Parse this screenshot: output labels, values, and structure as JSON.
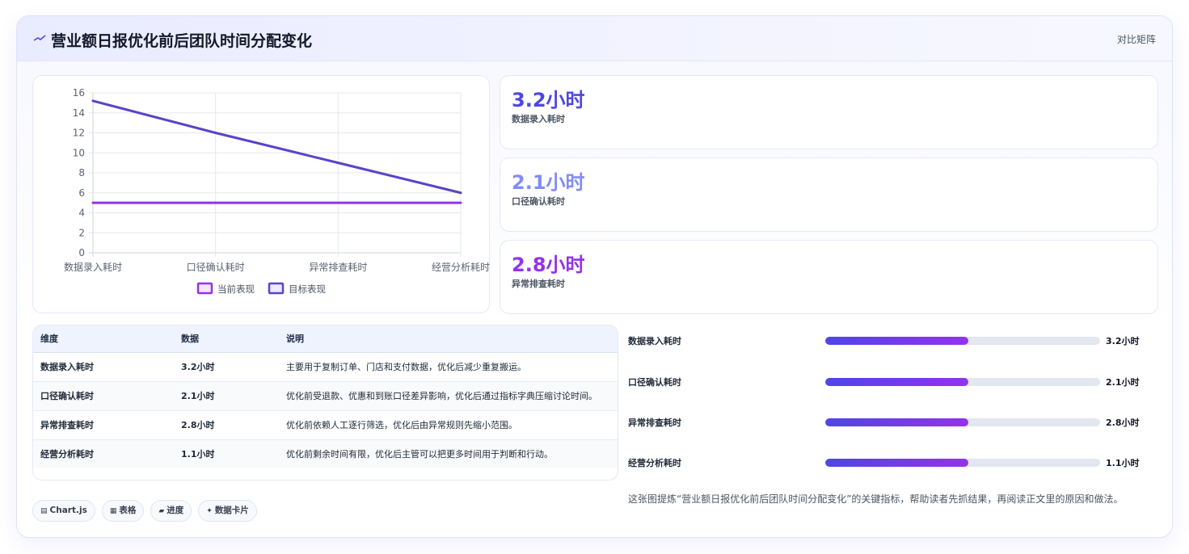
{
  "header": {
    "icon": "trend-line-icon",
    "title": "营业额日报优化前后团队时间分配变化",
    "link": "对比矩阵"
  },
  "colors": {
    "current_series": "#9333ea",
    "target_series": "#5b43c9",
    "stat1": "#4f46e5",
    "stat2": "#818cf8",
    "stat3": "#9333ea"
  },
  "chart_data": {
    "type": "line",
    "categories": [
      "数据录入耗时",
      "口径确认耗时",
      "异常排查耗时",
      "经营分析耗时"
    ],
    "series": [
      {
        "name": "当前表现",
        "values": [
          5,
          5,
          5,
          5
        ]
      },
      {
        "name": "目标表现",
        "values": [
          15.2,
          12,
          9,
          6
        ]
      }
    ],
    "ylim": [
      0,
      16
    ],
    "yticks": [
      0,
      2,
      4,
      6,
      8,
      10,
      12,
      14,
      16
    ],
    "grid": true,
    "legend": "bottom"
  },
  "stats": [
    {
      "value": "3.2小时",
      "label": "数据录入耗时"
    },
    {
      "value": "2.1小时",
      "label": "口径确认耗时"
    },
    {
      "value": "2.8小时",
      "label": "异常排查耗时"
    }
  ],
  "table": {
    "headers": [
      "维度",
      "数据",
      "说明"
    ],
    "rows": [
      [
        "数据录入耗时",
        "3.2小时",
        "主要用于复制订单、门店和支付数据，优化后减少重复搬运。"
      ],
      [
        "口径确认耗时",
        "2.1小时",
        "优化前受退款、优惠和到账口径差异影响，优化后通过指标字典压缩讨论时间。"
      ],
      [
        "异常排查耗时",
        "2.8小时",
        "优化前依赖人工逐行筛选，优化后由异常规则先缩小范围。"
      ],
      [
        "经营分析耗时",
        "1.1小时",
        "优化前剩余时间有限，优化后主管可以把更多时间用于判断和行动。"
      ]
    ]
  },
  "progress": [
    {
      "label": "数据录入耗时",
      "value": "3.2小时",
      "fraction": 0.52
    },
    {
      "label": "口径确认耗时",
      "value": "2.1小时",
      "fraction": 0.52
    },
    {
      "label": "异常排查耗时",
      "value": "2.8小时",
      "fraction": 0.52
    },
    {
      "label": "经营分析耗时",
      "value": "1.1小时",
      "fraction": 0.52
    }
  ],
  "caption": "这张图提炼“营业额日报优化前后团队时间分配变化”的关键指标，帮助读者先抓结果，再阅读正文里的原因和做法。",
  "chips": [
    {
      "icon": "chart-icon",
      "glyph": "▤",
      "label": "Chart.js"
    },
    {
      "icon": "table-icon",
      "glyph": "▦",
      "label": "表格"
    },
    {
      "icon": "progress-icon",
      "glyph": "▰",
      "label": "进度"
    },
    {
      "icon": "sparkle-icon",
      "glyph": "✦",
      "label": "数据卡片"
    }
  ]
}
